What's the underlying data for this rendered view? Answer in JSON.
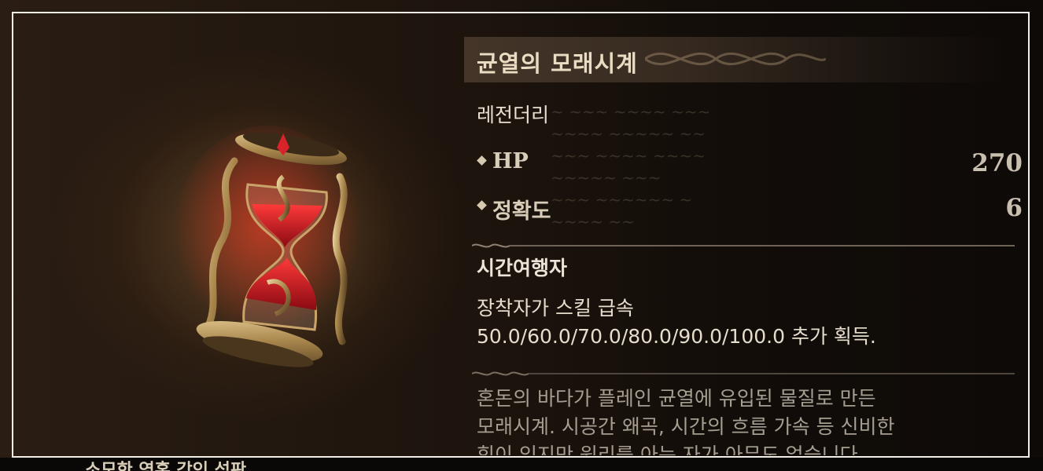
{
  "item": {
    "name": "균열의 모래시계",
    "rarity": "레전더리",
    "stats": [
      {
        "label": "HP",
        "value": "270"
      },
      {
        "label": "정확도",
        "value": "6"
      }
    ],
    "set_effect": {
      "name": "시간여행자",
      "line1": "장착자가 스킬 급속",
      "line2": "50.0/60.0/70.0/80.0/90.0/100.0 추가 획득."
    },
    "lore": {
      "line1": "혼돈의 바다가 플레인 균열에 유입된 물질로 만든",
      "line2": "모래시계. 시공간 왜곡, 시간의 흐름 가속 등 신비한",
      "line3": "힘이 있지만 원리를 아는 자가 아무도 없습니다."
    }
  },
  "background_text": "소모한 영혼 각인 석판",
  "colors": {
    "title": "#e9dcc3",
    "sand": "#c0101e",
    "gold": "#b89a5e"
  },
  "icons": [
    "hourglass-item-icon",
    "stat-diamond-icon",
    "ornament-divider-icon"
  ]
}
